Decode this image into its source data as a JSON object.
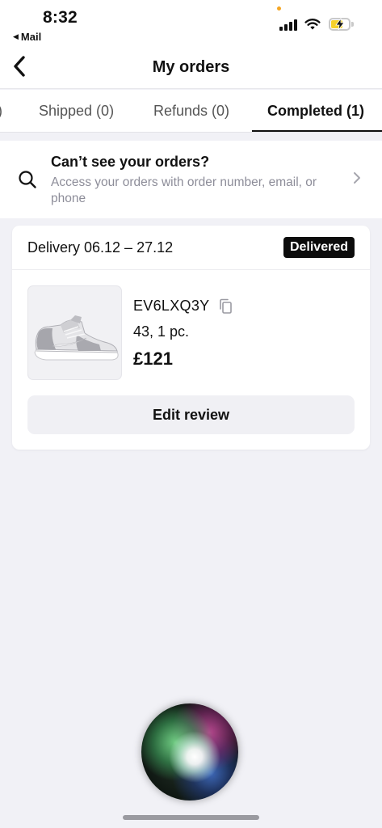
{
  "status_bar": {
    "time": "8:32",
    "back_app": "Mail"
  },
  "header": {
    "title": "My orders"
  },
  "tabs": [
    {
      "label": ")"
    },
    {
      "label": "Shipped (0)"
    },
    {
      "label": "Refunds (0)"
    },
    {
      "label": "Completed (1)",
      "active": true
    }
  ],
  "info_banner": {
    "title": "Can’t see your orders?",
    "subtitle": "Access your orders with order number, email, or phone"
  },
  "order": {
    "delivery": "Delivery 06.12 – 27.12",
    "status": "Delivered",
    "product_code": "EV6LXQ3Y",
    "size_qty": "43, 1 pc.",
    "price": "£121",
    "edit_review": "Edit review"
  },
  "icons": {
    "back": "chevron-left-icon",
    "search": "search-icon",
    "chevron": "chevron-right-icon",
    "copy": "copy-icon"
  },
  "colors": {
    "badge_bg": "#0c0c0c",
    "page_bg": "#f1f1f6",
    "muted_text": "#8d8d99"
  }
}
